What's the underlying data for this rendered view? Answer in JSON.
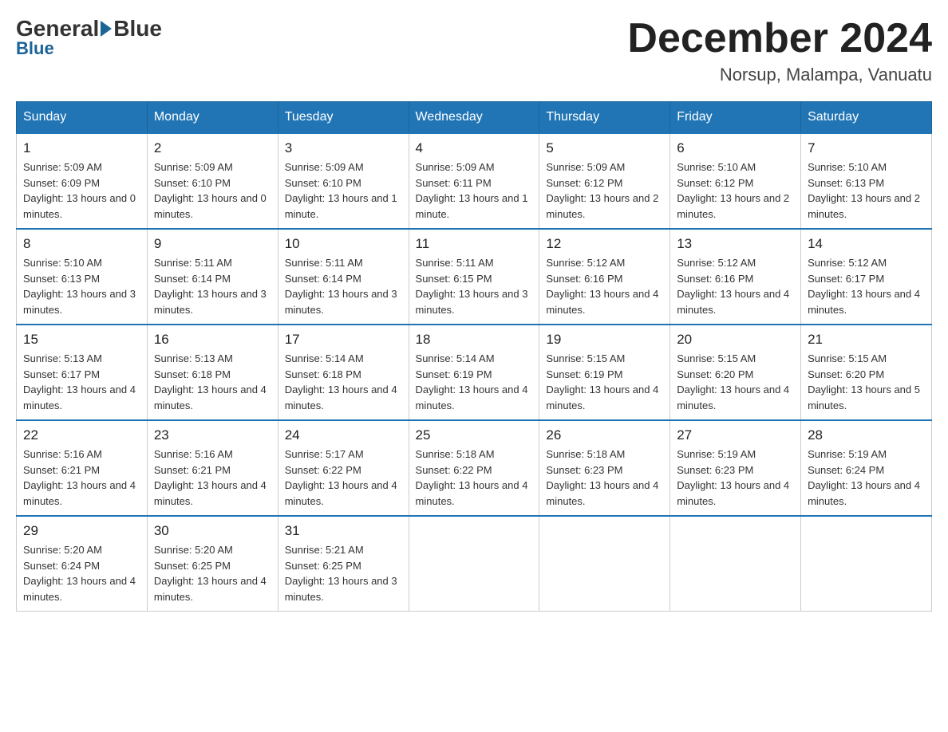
{
  "header": {
    "logo": {
      "general": "General",
      "blue": "Blue"
    },
    "month_title": "December 2024",
    "location": "Norsup, Malampa, Vanuatu"
  },
  "days_of_week": [
    "Sunday",
    "Monday",
    "Tuesday",
    "Wednesday",
    "Thursday",
    "Friday",
    "Saturday"
  ],
  "weeks": [
    [
      {
        "day": "1",
        "sunrise": "5:09 AM",
        "sunset": "6:09 PM",
        "daylight": "13 hours and 0 minutes."
      },
      {
        "day": "2",
        "sunrise": "5:09 AM",
        "sunset": "6:10 PM",
        "daylight": "13 hours and 0 minutes."
      },
      {
        "day": "3",
        "sunrise": "5:09 AM",
        "sunset": "6:10 PM",
        "daylight": "13 hours and 1 minute."
      },
      {
        "day": "4",
        "sunrise": "5:09 AM",
        "sunset": "6:11 PM",
        "daylight": "13 hours and 1 minute."
      },
      {
        "day": "5",
        "sunrise": "5:09 AM",
        "sunset": "6:12 PM",
        "daylight": "13 hours and 2 minutes."
      },
      {
        "day": "6",
        "sunrise": "5:10 AM",
        "sunset": "6:12 PM",
        "daylight": "13 hours and 2 minutes."
      },
      {
        "day": "7",
        "sunrise": "5:10 AM",
        "sunset": "6:13 PM",
        "daylight": "13 hours and 2 minutes."
      }
    ],
    [
      {
        "day": "8",
        "sunrise": "5:10 AM",
        "sunset": "6:13 PM",
        "daylight": "13 hours and 3 minutes."
      },
      {
        "day": "9",
        "sunrise": "5:11 AM",
        "sunset": "6:14 PM",
        "daylight": "13 hours and 3 minutes."
      },
      {
        "day": "10",
        "sunrise": "5:11 AM",
        "sunset": "6:14 PM",
        "daylight": "13 hours and 3 minutes."
      },
      {
        "day": "11",
        "sunrise": "5:11 AM",
        "sunset": "6:15 PM",
        "daylight": "13 hours and 3 minutes."
      },
      {
        "day": "12",
        "sunrise": "5:12 AM",
        "sunset": "6:16 PM",
        "daylight": "13 hours and 4 minutes."
      },
      {
        "day": "13",
        "sunrise": "5:12 AM",
        "sunset": "6:16 PM",
        "daylight": "13 hours and 4 minutes."
      },
      {
        "day": "14",
        "sunrise": "5:12 AM",
        "sunset": "6:17 PM",
        "daylight": "13 hours and 4 minutes."
      }
    ],
    [
      {
        "day": "15",
        "sunrise": "5:13 AM",
        "sunset": "6:17 PM",
        "daylight": "13 hours and 4 minutes."
      },
      {
        "day": "16",
        "sunrise": "5:13 AM",
        "sunset": "6:18 PM",
        "daylight": "13 hours and 4 minutes."
      },
      {
        "day": "17",
        "sunrise": "5:14 AM",
        "sunset": "6:18 PM",
        "daylight": "13 hours and 4 minutes."
      },
      {
        "day": "18",
        "sunrise": "5:14 AM",
        "sunset": "6:19 PM",
        "daylight": "13 hours and 4 minutes."
      },
      {
        "day": "19",
        "sunrise": "5:15 AM",
        "sunset": "6:19 PM",
        "daylight": "13 hours and 4 minutes."
      },
      {
        "day": "20",
        "sunrise": "5:15 AM",
        "sunset": "6:20 PM",
        "daylight": "13 hours and 4 minutes."
      },
      {
        "day": "21",
        "sunrise": "5:15 AM",
        "sunset": "6:20 PM",
        "daylight": "13 hours and 5 minutes."
      }
    ],
    [
      {
        "day": "22",
        "sunrise": "5:16 AM",
        "sunset": "6:21 PM",
        "daylight": "13 hours and 4 minutes."
      },
      {
        "day": "23",
        "sunrise": "5:16 AM",
        "sunset": "6:21 PM",
        "daylight": "13 hours and 4 minutes."
      },
      {
        "day": "24",
        "sunrise": "5:17 AM",
        "sunset": "6:22 PM",
        "daylight": "13 hours and 4 minutes."
      },
      {
        "day": "25",
        "sunrise": "5:18 AM",
        "sunset": "6:22 PM",
        "daylight": "13 hours and 4 minutes."
      },
      {
        "day": "26",
        "sunrise": "5:18 AM",
        "sunset": "6:23 PM",
        "daylight": "13 hours and 4 minutes."
      },
      {
        "day": "27",
        "sunrise": "5:19 AM",
        "sunset": "6:23 PM",
        "daylight": "13 hours and 4 minutes."
      },
      {
        "day": "28",
        "sunrise": "5:19 AM",
        "sunset": "6:24 PM",
        "daylight": "13 hours and 4 minutes."
      }
    ],
    [
      {
        "day": "29",
        "sunrise": "5:20 AM",
        "sunset": "6:24 PM",
        "daylight": "13 hours and 4 minutes."
      },
      {
        "day": "30",
        "sunrise": "5:20 AM",
        "sunset": "6:25 PM",
        "daylight": "13 hours and 4 minutes."
      },
      {
        "day": "31",
        "sunrise": "5:21 AM",
        "sunset": "6:25 PM",
        "daylight": "13 hours and 3 minutes."
      },
      null,
      null,
      null,
      null
    ]
  ],
  "labels": {
    "sunrise": "Sunrise:",
    "sunset": "Sunset:",
    "daylight": "Daylight:"
  }
}
